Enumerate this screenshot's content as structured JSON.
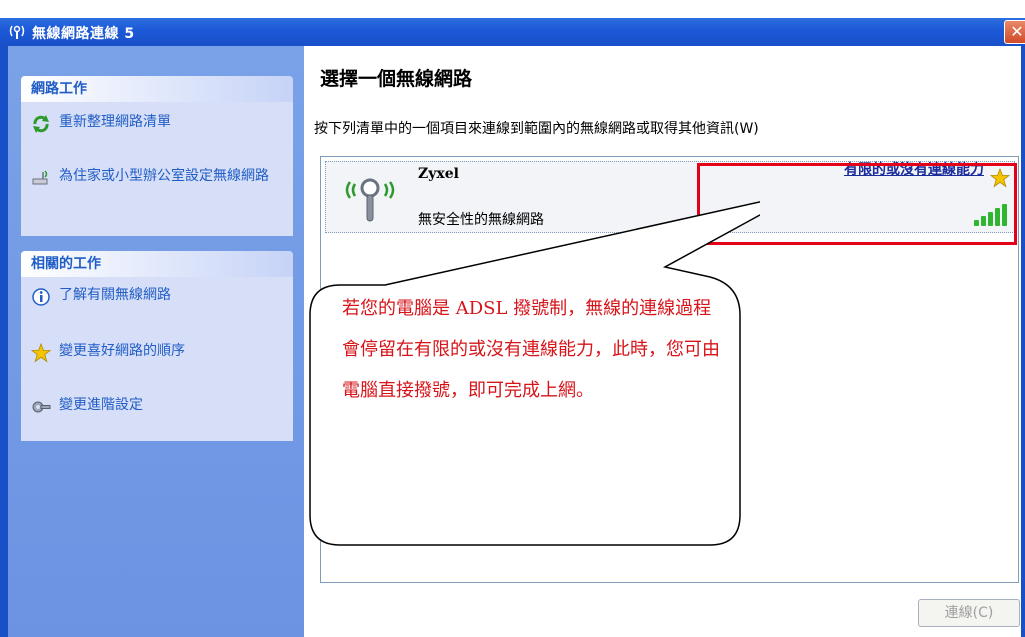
{
  "window": {
    "title": "無線網路連線 5",
    "close_label": "✕"
  },
  "sidebar": {
    "network_tasks": {
      "header": "網路工作",
      "items": [
        {
          "label": "重新整理網路清單",
          "icon": "refresh-icon"
        },
        {
          "label": "為住家或小型辦公室設定無線網路",
          "icon": "setup-wizard-icon"
        }
      ]
    },
    "related_tasks": {
      "header": "相關的工作",
      "items": [
        {
          "label": "了解有關無線網路",
          "icon": "info-icon"
        },
        {
          "label": "變更喜好網路的順序",
          "icon": "star-icon"
        },
        {
          "label": "變更進階設定",
          "icon": "wrench-icon"
        }
      ]
    }
  },
  "main": {
    "title": "選擇一個無線網路",
    "description": "按下列清單中的一個項目來連線到範圍內的無線網路或取得其他資訊(W)",
    "network": {
      "name": "Zyxel",
      "security": "無安全性的無線網路",
      "status": "有限的或沒有連線能力",
      "signal_level": 5,
      "signal_max": 5
    },
    "connect_button": "連線(C)"
  },
  "callout": {
    "text": "若您的電腦是 ADSL 撥號制，無線的連線過程會停留在有限的或沒有連線能力，此時，您可由電腦直接撥號，即可完成上網。"
  }
}
